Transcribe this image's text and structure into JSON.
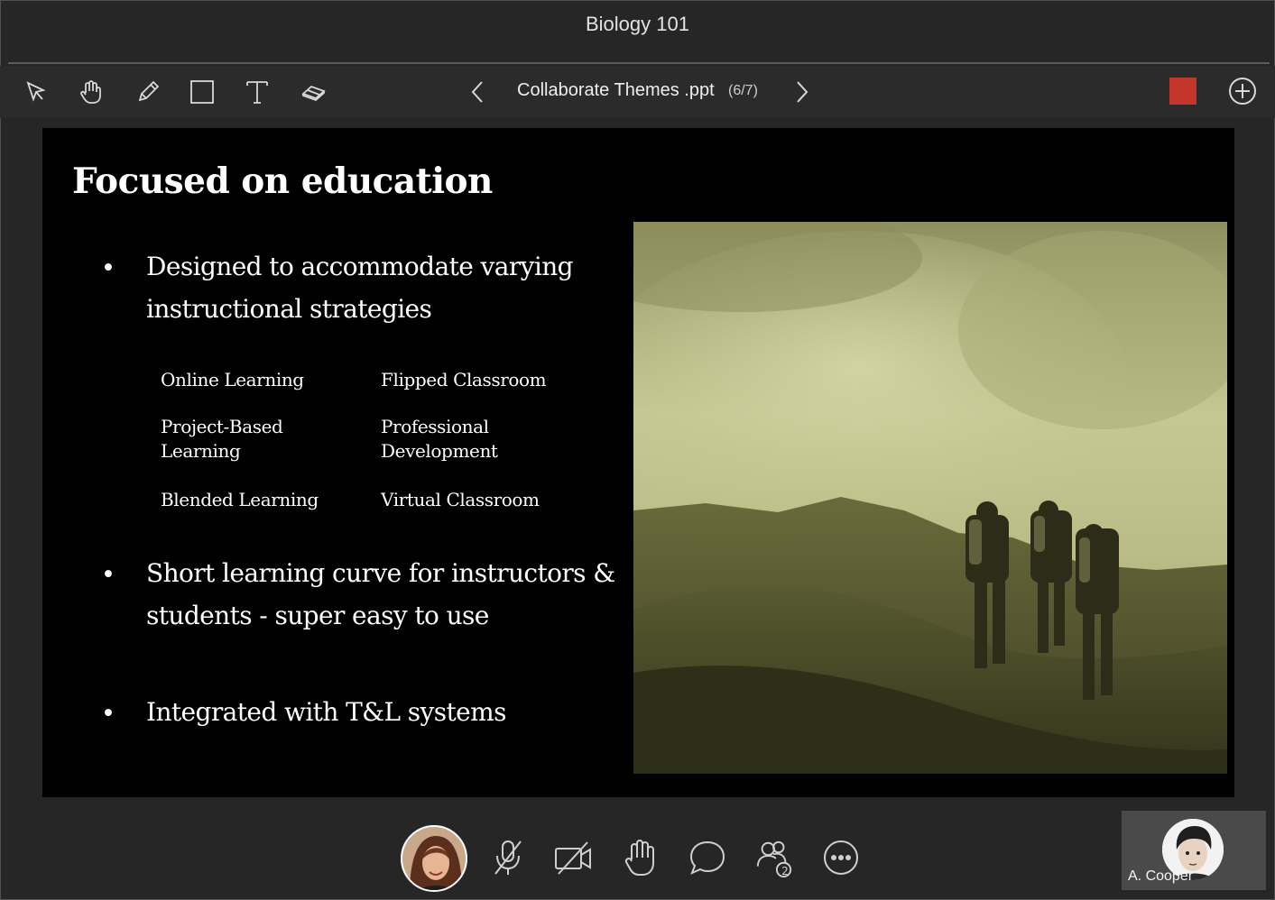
{
  "window": {
    "title": "Biology 101"
  },
  "toolbar": {
    "tools": [
      "select-pointer-icon",
      "pan-hand-icon",
      "pencil-icon",
      "rectangle-icon",
      "text-icon",
      "eraser-icon"
    ],
    "document_name": "Collaborate Themes .ppt",
    "page_indicator": "(6/7)",
    "color": "#c4362c"
  },
  "slide": {
    "title": "Focused on education",
    "bullet_symbol": "•",
    "bullets": [
      "Designed to accommodate varying instructional strategies",
      "Short learning curve for instructors & students - super easy to use",
      "Integrated with T&L systems"
    ],
    "strategies": [
      "Online  Learning",
      "Flipped Classroom",
      "Project-Based Learning",
      "Professional Development",
      "Blended Learning",
      "Virtual Classroom"
    ]
  },
  "controls": [
    "microphone-muted-icon",
    "camera-off-icon",
    "raise-hand-icon",
    "chat-icon",
    "attendees-icon",
    "more-options-icon"
  ],
  "attendees_count": "2",
  "participant": {
    "name": "A. Cooper"
  }
}
